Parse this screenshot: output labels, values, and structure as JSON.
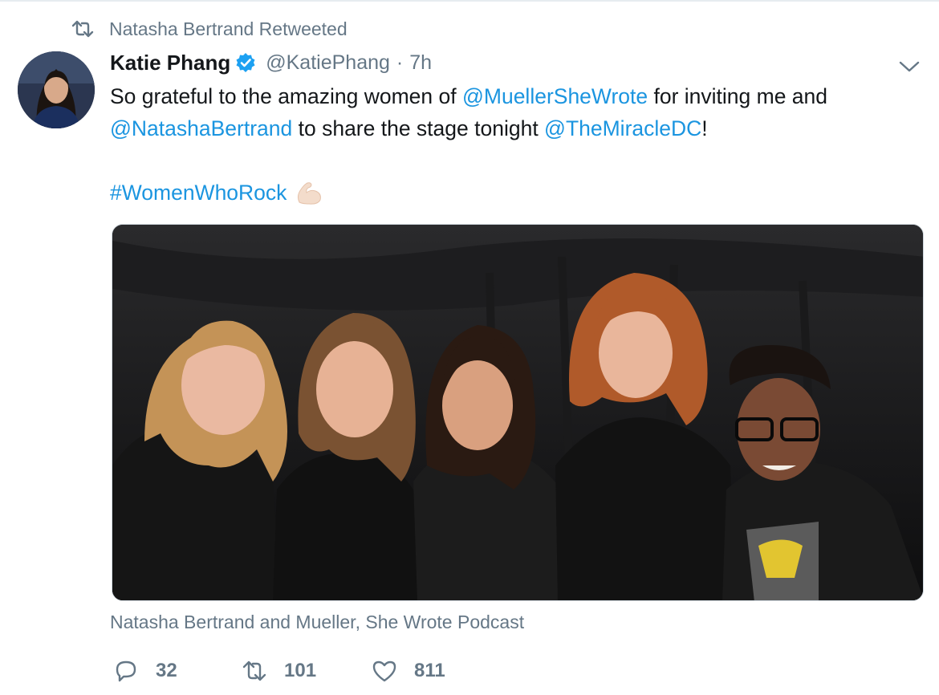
{
  "retweet_context": {
    "label": "Natasha Bertrand Retweeted",
    "icon": "retweet-icon"
  },
  "author": {
    "display_name": "Katie Phang",
    "handle": "@KatiePhang",
    "separator": "·",
    "time": "7h",
    "verified": true
  },
  "tweet": {
    "segments_line1": [
      {
        "text": "So grateful to the amazing women of ",
        "type": "text"
      },
      {
        "text": "@MuellerSheWrote",
        "type": "mention"
      },
      {
        "text": " for inviting me and",
        "type": "text"
      }
    ],
    "segments_line2": [
      {
        "text": "@NatashaBertrand",
        "type": "mention"
      },
      {
        "text": " to share the stage tonight ",
        "type": "text"
      },
      {
        "text": "@TheMiracleDC",
        "type": "mention"
      },
      {
        "text": "!",
        "type": "text"
      }
    ],
    "hashtag": "#WomenWhoRock",
    "emoji_icon": "flexed-biceps-icon"
  },
  "media": {
    "tagged_people": "Natasha Bertrand and Mueller, She Wrote Podcast"
  },
  "actions": {
    "reply_count": "32",
    "retweet_count": "101",
    "like_count": "811"
  },
  "colors": {
    "link": "#1b95e0",
    "muted": "#657786",
    "text": "#14171a",
    "verified": "#1da1f2"
  }
}
